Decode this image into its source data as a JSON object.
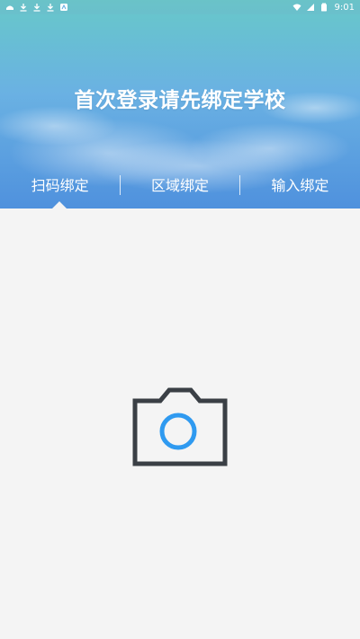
{
  "status_bar": {
    "left_icons": [
      "app-notification-icon",
      "download-icon",
      "download-icon",
      "download-icon",
      "app-icon"
    ],
    "right_icons": [
      "wifi-icon",
      "signal-icon",
      "battery-icon"
    ],
    "time": "9:01"
  },
  "header": {
    "title": "首次登录请先绑定学校"
  },
  "tabs": [
    {
      "label": "扫码绑定",
      "selected": true
    },
    {
      "label": "区域绑定",
      "selected": false
    },
    {
      "label": "输入绑定",
      "selected": false
    }
  ],
  "camera": {
    "icon": "camera-icon",
    "outline_color": "#3a3f45",
    "lens_color": "#2f9af0"
  },
  "colors": {
    "background": "#f4f4f4",
    "hero_gradient_top": "#67c8c9",
    "hero_gradient_bottom": "#4f91dd"
  }
}
